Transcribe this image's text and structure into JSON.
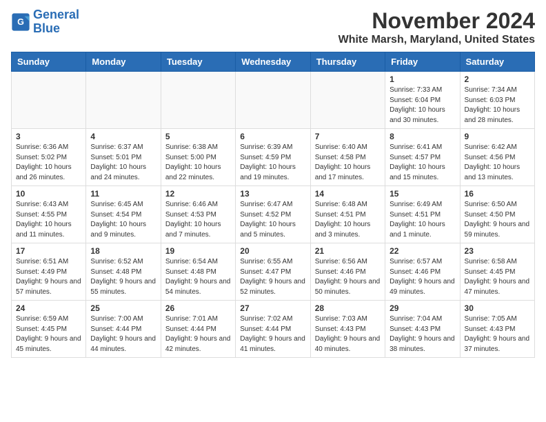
{
  "header": {
    "logo_line1": "General",
    "logo_line2": "Blue",
    "month": "November 2024",
    "location": "White Marsh, Maryland, United States"
  },
  "days_of_week": [
    "Sunday",
    "Monday",
    "Tuesday",
    "Wednesday",
    "Thursday",
    "Friday",
    "Saturday"
  ],
  "weeks": [
    [
      {
        "day": "",
        "info": ""
      },
      {
        "day": "",
        "info": ""
      },
      {
        "day": "",
        "info": ""
      },
      {
        "day": "",
        "info": ""
      },
      {
        "day": "",
        "info": ""
      },
      {
        "day": "1",
        "info": "Sunrise: 7:33 AM\nSunset: 6:04 PM\nDaylight: 10 hours and 30 minutes."
      },
      {
        "day": "2",
        "info": "Sunrise: 7:34 AM\nSunset: 6:03 PM\nDaylight: 10 hours and 28 minutes."
      }
    ],
    [
      {
        "day": "3",
        "info": "Sunrise: 6:36 AM\nSunset: 5:02 PM\nDaylight: 10 hours and 26 minutes."
      },
      {
        "day": "4",
        "info": "Sunrise: 6:37 AM\nSunset: 5:01 PM\nDaylight: 10 hours and 24 minutes."
      },
      {
        "day": "5",
        "info": "Sunrise: 6:38 AM\nSunset: 5:00 PM\nDaylight: 10 hours and 22 minutes."
      },
      {
        "day": "6",
        "info": "Sunrise: 6:39 AM\nSunset: 4:59 PM\nDaylight: 10 hours and 19 minutes."
      },
      {
        "day": "7",
        "info": "Sunrise: 6:40 AM\nSunset: 4:58 PM\nDaylight: 10 hours and 17 minutes."
      },
      {
        "day": "8",
        "info": "Sunrise: 6:41 AM\nSunset: 4:57 PM\nDaylight: 10 hours and 15 minutes."
      },
      {
        "day": "9",
        "info": "Sunrise: 6:42 AM\nSunset: 4:56 PM\nDaylight: 10 hours and 13 minutes."
      }
    ],
    [
      {
        "day": "10",
        "info": "Sunrise: 6:43 AM\nSunset: 4:55 PM\nDaylight: 10 hours and 11 minutes."
      },
      {
        "day": "11",
        "info": "Sunrise: 6:45 AM\nSunset: 4:54 PM\nDaylight: 10 hours and 9 minutes."
      },
      {
        "day": "12",
        "info": "Sunrise: 6:46 AM\nSunset: 4:53 PM\nDaylight: 10 hours and 7 minutes."
      },
      {
        "day": "13",
        "info": "Sunrise: 6:47 AM\nSunset: 4:52 PM\nDaylight: 10 hours and 5 minutes."
      },
      {
        "day": "14",
        "info": "Sunrise: 6:48 AM\nSunset: 4:51 PM\nDaylight: 10 hours and 3 minutes."
      },
      {
        "day": "15",
        "info": "Sunrise: 6:49 AM\nSunset: 4:51 PM\nDaylight: 10 hours and 1 minute."
      },
      {
        "day": "16",
        "info": "Sunrise: 6:50 AM\nSunset: 4:50 PM\nDaylight: 9 hours and 59 minutes."
      }
    ],
    [
      {
        "day": "17",
        "info": "Sunrise: 6:51 AM\nSunset: 4:49 PM\nDaylight: 9 hours and 57 minutes."
      },
      {
        "day": "18",
        "info": "Sunrise: 6:52 AM\nSunset: 4:48 PM\nDaylight: 9 hours and 55 minutes."
      },
      {
        "day": "19",
        "info": "Sunrise: 6:54 AM\nSunset: 4:48 PM\nDaylight: 9 hours and 54 minutes."
      },
      {
        "day": "20",
        "info": "Sunrise: 6:55 AM\nSunset: 4:47 PM\nDaylight: 9 hours and 52 minutes."
      },
      {
        "day": "21",
        "info": "Sunrise: 6:56 AM\nSunset: 4:46 PM\nDaylight: 9 hours and 50 minutes."
      },
      {
        "day": "22",
        "info": "Sunrise: 6:57 AM\nSunset: 4:46 PM\nDaylight: 9 hours and 49 minutes."
      },
      {
        "day": "23",
        "info": "Sunrise: 6:58 AM\nSunset: 4:45 PM\nDaylight: 9 hours and 47 minutes."
      }
    ],
    [
      {
        "day": "24",
        "info": "Sunrise: 6:59 AM\nSunset: 4:45 PM\nDaylight: 9 hours and 45 minutes."
      },
      {
        "day": "25",
        "info": "Sunrise: 7:00 AM\nSunset: 4:44 PM\nDaylight: 9 hours and 44 minutes."
      },
      {
        "day": "26",
        "info": "Sunrise: 7:01 AM\nSunset: 4:44 PM\nDaylight: 9 hours and 42 minutes."
      },
      {
        "day": "27",
        "info": "Sunrise: 7:02 AM\nSunset: 4:44 PM\nDaylight: 9 hours and 41 minutes."
      },
      {
        "day": "28",
        "info": "Sunrise: 7:03 AM\nSunset: 4:43 PM\nDaylight: 9 hours and 40 minutes."
      },
      {
        "day": "29",
        "info": "Sunrise: 7:04 AM\nSunset: 4:43 PM\nDaylight: 9 hours and 38 minutes."
      },
      {
        "day": "30",
        "info": "Sunrise: 7:05 AM\nSunset: 4:43 PM\nDaylight: 9 hours and 37 minutes."
      }
    ]
  ]
}
